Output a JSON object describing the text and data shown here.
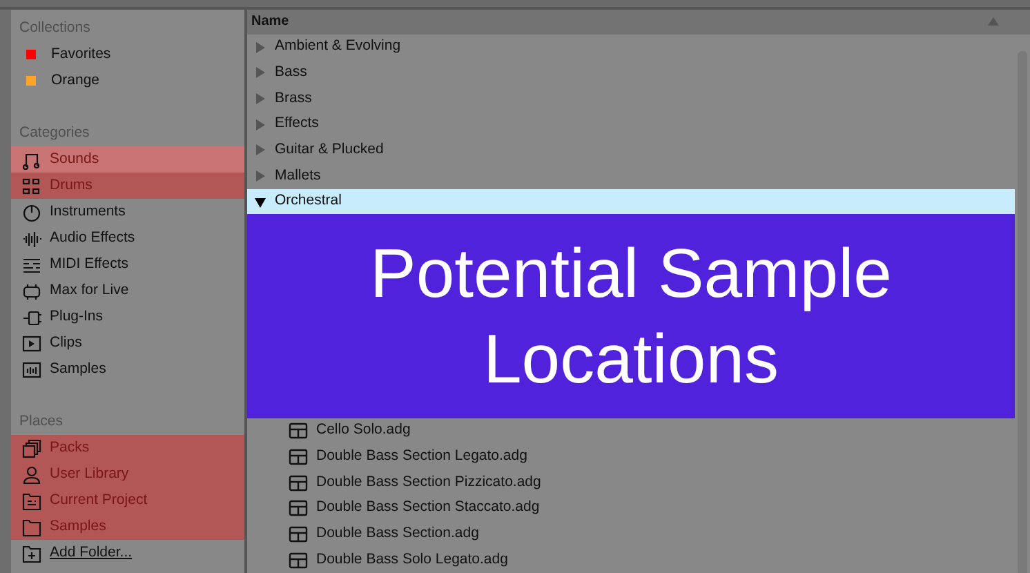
{
  "collections": {
    "title": "Collections",
    "items": [
      {
        "label": "Favorites",
        "color": "#ff0000"
      },
      {
        "label": "Orange",
        "color": "#ffa426"
      }
    ]
  },
  "categories": {
    "title": "Categories",
    "items": [
      {
        "label": "Sounds",
        "highlighted": true,
        "selected": true
      },
      {
        "label": "Drums",
        "highlighted": true,
        "selected": false
      },
      {
        "label": "Instruments",
        "highlighted": false,
        "selected": false
      },
      {
        "label": "Audio Effects",
        "highlighted": false,
        "selected": false
      },
      {
        "label": "MIDI Effects",
        "highlighted": false,
        "selected": false
      },
      {
        "label": "Max for Live",
        "highlighted": false,
        "selected": false
      },
      {
        "label": "Plug-Ins",
        "highlighted": false,
        "selected": false
      },
      {
        "label": "Clips",
        "highlighted": false,
        "selected": false
      },
      {
        "label": "Samples",
        "highlighted": false,
        "selected": false
      }
    ]
  },
  "places": {
    "title": "Places",
    "items": [
      {
        "label": "Packs",
        "highlighted": true,
        "selected": false
      },
      {
        "label": "User Library",
        "highlighted": true,
        "selected": false
      },
      {
        "label": "Current Project",
        "highlighted": true,
        "selected": false
      },
      {
        "label": "Samples",
        "highlighted": true,
        "selected": false
      }
    ],
    "add_folder": "Add Folder..."
  },
  "browser": {
    "column": "Name",
    "folders": [
      {
        "label": "Ambient & Evolving",
        "expanded": false,
        "selected": false
      },
      {
        "label": "Bass",
        "expanded": false,
        "selected": false
      },
      {
        "label": "Brass",
        "expanded": false,
        "selected": false
      },
      {
        "label": "Effects",
        "expanded": false,
        "selected": false
      },
      {
        "label": "Guitar & Plucked",
        "expanded": false,
        "selected": false
      },
      {
        "label": "Mallets",
        "expanded": false,
        "selected": false
      },
      {
        "label": "Orchestral",
        "expanded": true,
        "selected": true,
        "children": [
          "Cello Solo.adg",
          "Double Bass Section Legato.adg",
          "Double Bass Section Pizzicato.adg",
          "Double Bass Section Staccato.adg",
          "Double Bass Section.adg",
          "Double Bass Solo Legato.adg"
        ]
      }
    ]
  },
  "overlay": {
    "text": "Potential Sample Locations"
  }
}
